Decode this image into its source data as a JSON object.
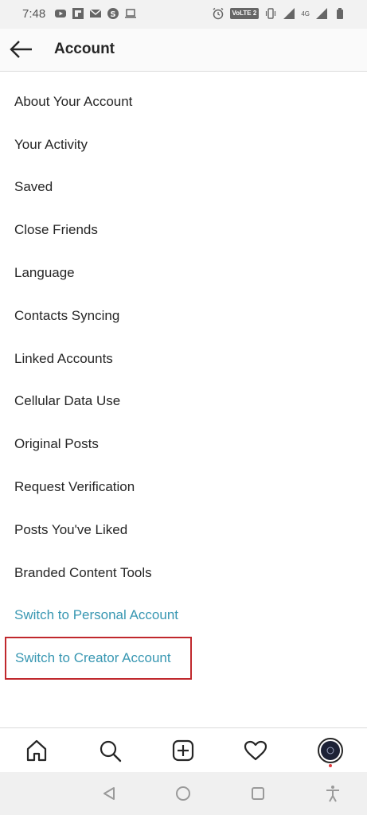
{
  "status_bar": {
    "time": "7:48",
    "network_badge": "VoLTE 2",
    "network_type": "4G"
  },
  "header": {
    "title": "Account",
    "back_icon": "arrow-left-icon"
  },
  "menu_items": [
    "About Your Account",
    "Your Activity",
    "Saved",
    "Close Friends",
    "Language",
    "Contacts Syncing",
    "Linked Accounts",
    "Cellular Data Use",
    "Original Posts",
    "Request Verification",
    "Posts You've Liked",
    "Branded Content Tools"
  ],
  "switch_links": {
    "personal": "Switch to Personal Account",
    "creator": "Switch to Creator Account"
  },
  "bottom_tabs": [
    "home-icon",
    "search-icon",
    "new-post-icon",
    "activity-heart-icon",
    "profile-avatar"
  ],
  "colors": {
    "link": "#3897b2",
    "highlight_border": "#c0282d"
  }
}
